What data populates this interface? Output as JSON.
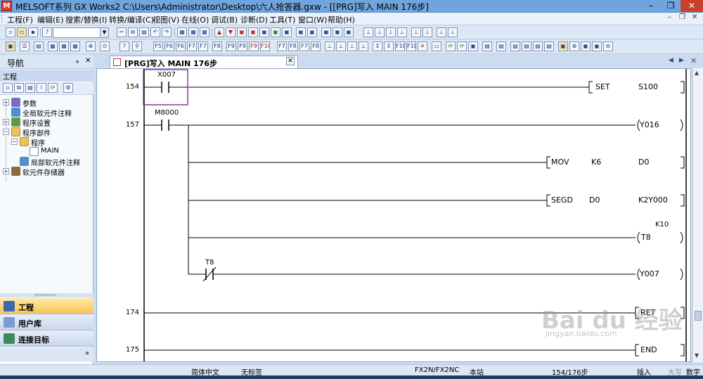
{
  "app": {
    "icon_letter": "M",
    "title": "MELSOFT系列 GX Works2 C:\\Users\\Administrator\\Desktop\\六人抢答器.gxw - [[PRG]写入 MAIN 176步]",
    "minimize": "–",
    "restore": "❐",
    "close": "✕"
  },
  "menu": [
    "工程(F)",
    "编辑(E)",
    "搜索/替换(I)",
    "转换/编译(C)",
    "视图(V)",
    "在线(O)",
    "调试(B)",
    "诊断(D)",
    "工具(T)",
    "窗口(W)",
    "帮助(H)"
  ],
  "mdi_controls": {
    "minimize": "–",
    "restore": "❐",
    "close": "✕"
  },
  "nav": {
    "title": "导航",
    "pin": "ᵩ",
    "close": "✕",
    "section": "工程",
    "tree": [
      {
        "label": "参数",
        "icon": "parameter-icon"
      },
      {
        "label": "全局软元件注释",
        "icon": "comment-icon"
      },
      {
        "label": "程序设置",
        "icon": "settings-icon"
      },
      {
        "label": "程序部件",
        "icon": "folder-icon"
      },
      {
        "label": "程序",
        "icon": "folder-icon"
      },
      {
        "label": "MAIN",
        "icon": "program-icon"
      },
      {
        "label": "局部软元件注释",
        "icon": "comment-icon"
      },
      {
        "label": "软元件存储器",
        "icon": "memory-icon"
      }
    ],
    "categories": [
      {
        "label": "工程",
        "active": true
      },
      {
        "label": "用户库",
        "active": false
      },
      {
        "label": "连接目标",
        "active": false
      }
    ],
    "more": "»"
  },
  "doc_tab": {
    "label": "[PRG]写入 MAIN 176步",
    "close": "✕"
  },
  "ladder": {
    "steps": [
      {
        "num": "154"
      },
      {
        "num": "157"
      },
      {
        "num": "174"
      },
      {
        "num": "175"
      }
    ],
    "contacts": {
      "x007": "X007",
      "m8000": "M8000",
      "t8": "T8"
    },
    "instructions": {
      "set_op": "SET",
      "set_arg": "S100",
      "out_y016": "Y016",
      "mov_op": "MOV",
      "mov_arg1": "K6",
      "mov_arg2": "D0",
      "segd_op": "SEGD",
      "segd_arg1": "D0",
      "segd_arg2": "K2Y000",
      "timer_const": "K10",
      "out_t8": "T8",
      "out_y007": "Y007",
      "ret": "RET",
      "end": "END"
    }
  },
  "watermark": {
    "brand": "Bai du 经验",
    "url": "jingyan.baidu.com"
  },
  "status": {
    "lang": "简体中文",
    "label": "无标签",
    "plc": "FX2N/FX2NC",
    "station": "本站",
    "step": "154/176步",
    "mode": "插入",
    "caps": "大写",
    "num": "数字"
  },
  "colors": {
    "title_bar": "#6fa4dc",
    "cursor_box": "#8a3a9e",
    "active_category": "#f6c45a"
  }
}
